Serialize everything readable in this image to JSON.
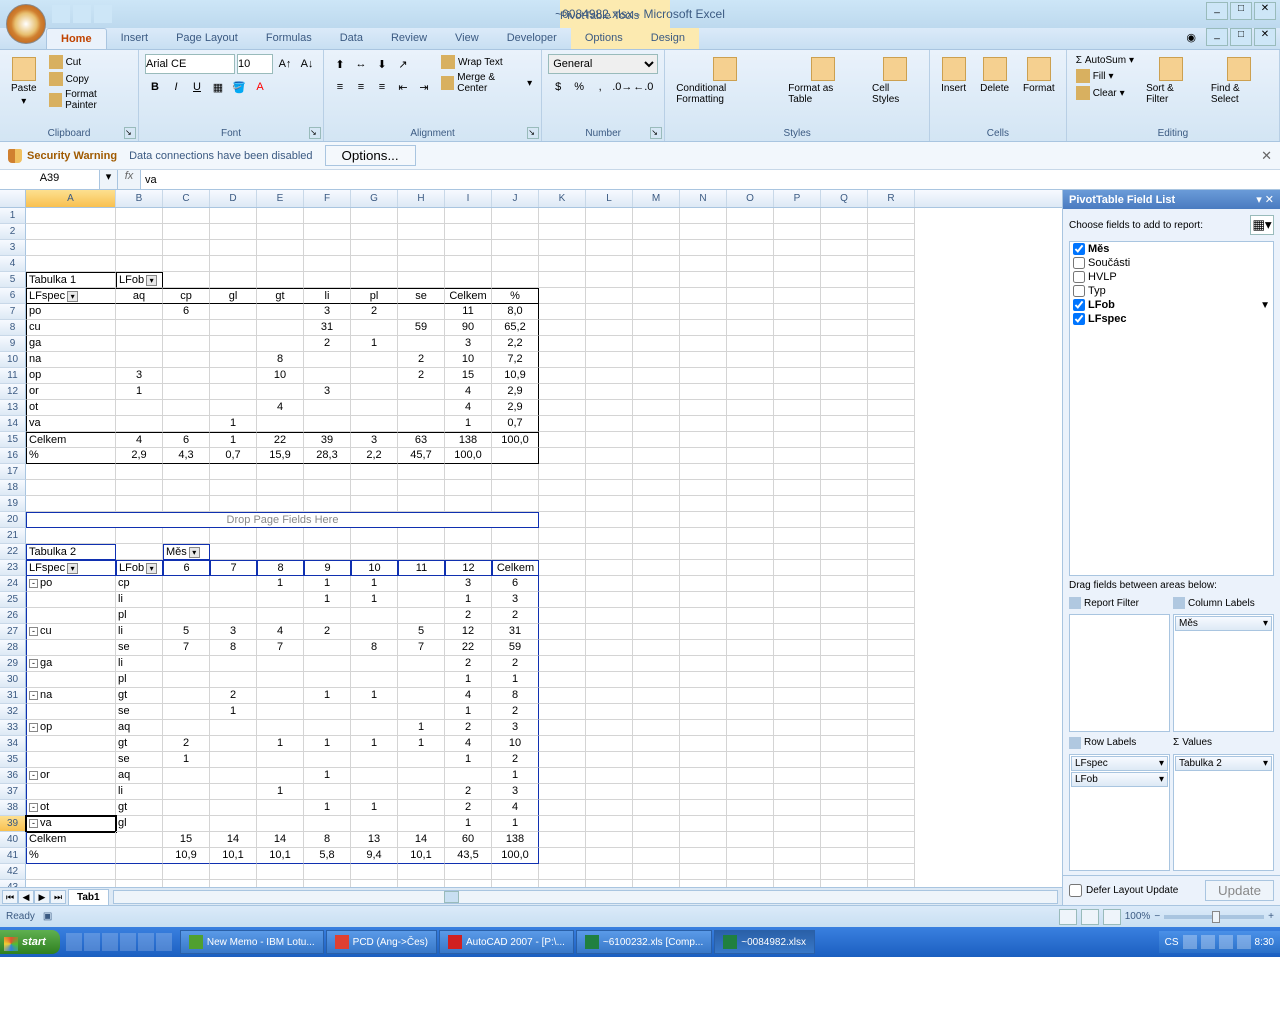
{
  "titlebar": {
    "title": "~0084982.xlsx - Microsoft Excel",
    "context_tools": "PivotTable Tools"
  },
  "ribbon_tabs": [
    "Home",
    "Insert",
    "Page Layout",
    "Formulas",
    "Data",
    "Review",
    "View",
    "Developer",
    "Options",
    "Design"
  ],
  "ribbon": {
    "clipboard": {
      "label": "Clipboard",
      "paste": "Paste",
      "cut": "Cut",
      "copy": "Copy",
      "format_painter": "Format Painter"
    },
    "font": {
      "label": "Font",
      "name": "Arial CE",
      "size": "10"
    },
    "alignment": {
      "label": "Alignment",
      "wrap": "Wrap Text",
      "merge": "Merge & Center"
    },
    "number": {
      "label": "Number",
      "format": "General"
    },
    "styles": {
      "label": "Styles",
      "cond": "Conditional Formatting",
      "table": "Format as Table",
      "cell": "Cell Styles"
    },
    "cells": {
      "label": "Cells",
      "insert": "Insert",
      "delete": "Delete",
      "format": "Format"
    },
    "editing": {
      "label": "Editing",
      "autosum": "AutoSum",
      "fill": "Fill",
      "clear": "Clear",
      "sort": "Sort & Filter",
      "find": "Find & Select"
    }
  },
  "security": {
    "warning": "Security Warning",
    "msg": "Data connections have been disabled",
    "options": "Options..."
  },
  "formula": {
    "name_box": "A39",
    "value": "va"
  },
  "columns": [
    "A",
    "B",
    "C",
    "D",
    "E",
    "F",
    "G",
    "H",
    "I",
    "J",
    "K",
    "L",
    "M",
    "N",
    "O",
    "P",
    "Q",
    "R"
  ],
  "sheet": {
    "t1_title": "Tabulka 1",
    "t1_hdr_row": [
      "LFspec",
      "aq",
      "cp",
      "gl",
      "gt",
      "li",
      "pl",
      "se",
      "Celkem",
      "%"
    ],
    "t1_lfob": "LFob",
    "t1_rows": [
      {
        "r": 7,
        "a": "po",
        "vals": [
          "",
          "6",
          "",
          "",
          "3",
          "2",
          "",
          "11",
          "8,0"
        ]
      },
      {
        "r": 8,
        "a": "cu",
        "vals": [
          "",
          "",
          "",
          "",
          "31",
          "",
          "59",
          "90",
          "65,2"
        ]
      },
      {
        "r": 9,
        "a": "ga",
        "vals": [
          "",
          "",
          "",
          "",
          "2",
          "1",
          "",
          "3",
          "2,2"
        ]
      },
      {
        "r": 10,
        "a": "na",
        "vals": [
          "",
          "",
          "",
          "8",
          "",
          "",
          "2",
          "10",
          "7,2"
        ]
      },
      {
        "r": 11,
        "a": "op",
        "vals": [
          "3",
          "",
          "",
          "10",
          "",
          "",
          "2",
          "15",
          "10,9"
        ]
      },
      {
        "r": 12,
        "a": "or",
        "vals": [
          "1",
          "",
          "",
          "",
          "3",
          "",
          "",
          "4",
          "2,9"
        ]
      },
      {
        "r": 13,
        "a": "ot",
        "vals": [
          "",
          "",
          "",
          "4",
          "",
          "",
          "",
          "4",
          "2,9"
        ]
      },
      {
        "r": 14,
        "a": "va",
        "vals": [
          "",
          "",
          "1",
          "",
          "",
          "",
          "",
          "1",
          "0,7"
        ]
      },
      {
        "r": 15,
        "a": "Celkem",
        "vals": [
          "4",
          "6",
          "1",
          "22",
          "39",
          "3",
          "63",
          "138",
          "100,0"
        ]
      },
      {
        "r": 16,
        "a": "%",
        "vals": [
          "2,9",
          "4,3",
          "0,7",
          "15,9",
          "28,3",
          "2,2",
          "45,7",
          "100,0",
          ""
        ]
      }
    ],
    "drop_zone": "Drop Page Fields Here",
    "t2_title": "Tabulka 2",
    "t2_mes": "Měs",
    "t2_hdr": [
      "LFspec",
      "LFob",
      "6",
      "7",
      "8",
      "9",
      "10",
      "11",
      "12",
      "Celkem"
    ],
    "t2_rows": [
      {
        "r": 24,
        "exp": "-",
        "a": "po",
        "b": "cp",
        "v": [
          "",
          "",
          "1",
          "1",
          "1",
          "",
          "3",
          "6"
        ]
      },
      {
        "r": 25,
        "exp": "",
        "a": "",
        "b": "li",
        "v": [
          "",
          "",
          "",
          "1",
          "1",
          "",
          "1",
          "3"
        ]
      },
      {
        "r": 26,
        "exp": "",
        "a": "",
        "b": "pl",
        "v": [
          "",
          "",
          "",
          "",
          "",
          "",
          "2",
          "2"
        ]
      },
      {
        "r": 27,
        "exp": "-",
        "a": "cu",
        "b": "li",
        "v": [
          "5",
          "3",
          "4",
          "2",
          "",
          "5",
          "12",
          "31"
        ]
      },
      {
        "r": 28,
        "exp": "",
        "a": "",
        "b": "se",
        "v": [
          "7",
          "8",
          "7",
          "",
          "8",
          "7",
          "22",
          "59"
        ]
      },
      {
        "r": 29,
        "exp": "-",
        "a": "ga",
        "b": "li",
        "v": [
          "",
          "",
          "",
          "",
          "",
          "",
          "2",
          "2"
        ]
      },
      {
        "r": 30,
        "exp": "",
        "a": "",
        "b": "pl",
        "v": [
          "",
          "",
          "",
          "",
          "",
          "",
          "1",
          "1"
        ]
      },
      {
        "r": 31,
        "exp": "-",
        "a": "na",
        "b": "gt",
        "v": [
          "",
          "2",
          "",
          "1",
          "1",
          "",
          "4",
          "8"
        ]
      },
      {
        "r": 32,
        "exp": "",
        "a": "",
        "b": "se",
        "v": [
          "",
          "1",
          "",
          "",
          "",
          "",
          "1",
          "2"
        ]
      },
      {
        "r": 33,
        "exp": "-",
        "a": "op",
        "b": "aq",
        "v": [
          "",
          "",
          "",
          "",
          "",
          "1",
          "2",
          "3"
        ]
      },
      {
        "r": 34,
        "exp": "",
        "a": "",
        "b": "gt",
        "v": [
          "2",
          "",
          "1",
          "1",
          "1",
          "1",
          "4",
          "10"
        ]
      },
      {
        "r": 35,
        "exp": "",
        "a": "",
        "b": "se",
        "v": [
          "1",
          "",
          "",
          "",
          "",
          "",
          "1",
          "2"
        ]
      },
      {
        "r": 36,
        "exp": "-",
        "a": "or",
        "b": "aq",
        "v": [
          "",
          "",
          "",
          "1",
          "",
          "",
          "",
          "1"
        ]
      },
      {
        "r": 37,
        "exp": "",
        "a": "",
        "b": "li",
        "v": [
          "",
          "",
          "1",
          "",
          "",
          "",
          "2",
          "3"
        ]
      },
      {
        "r": 38,
        "exp": "-",
        "a": "ot",
        "b": "gt",
        "v": [
          "",
          "",
          "",
          "1",
          "1",
          "",
          "2",
          "4"
        ]
      },
      {
        "r": 39,
        "exp": "-",
        "a": "va",
        "b": "gl",
        "v": [
          "",
          "",
          "",
          "",
          "",
          "",
          "1",
          "1"
        ]
      },
      {
        "r": 40,
        "exp": "",
        "a": "Celkem",
        "b": "",
        "v": [
          "15",
          "14",
          "14",
          "8",
          "13",
          "14",
          "60",
          "138"
        ]
      },
      {
        "r": 41,
        "exp": "",
        "a": "%",
        "b": "",
        "v": [
          "10,9",
          "10,1",
          "10,1",
          "5,8",
          "9,4",
          "10,1",
          "43,5",
          "100,0"
        ]
      }
    ]
  },
  "sheet_tab": "Tab1",
  "status": {
    "ready": "Ready",
    "zoom": "100%"
  },
  "field_pane": {
    "title": "PivotTable Field List",
    "choose": "Choose fields to add to report:",
    "fields": [
      {
        "name": "Měs",
        "checked": true,
        "bold": true
      },
      {
        "name": "Součásti",
        "checked": false,
        "bold": false
      },
      {
        "name": "HVLP",
        "checked": false,
        "bold": false
      },
      {
        "name": "Typ",
        "checked": false,
        "bold": false
      },
      {
        "name": "LFob",
        "checked": true,
        "bold": true,
        "filter": true
      },
      {
        "name": "LFspec",
        "checked": true,
        "bold": true
      }
    ],
    "drag_label": "Drag fields between areas below:",
    "areas": {
      "report_filter": "Report Filter",
      "column_labels": "Column Labels",
      "row_labels": "Row Labels",
      "values": "Values",
      "col_items": [
        "Měs"
      ],
      "row_items": [
        "LFspec",
        "LFob"
      ],
      "val_items": [
        "Tabulka 2"
      ]
    },
    "defer": "Defer Layout Update",
    "update": "Update"
  },
  "taskbar": {
    "start": "start",
    "items": [
      "New Memo - IBM Lotu...",
      "PCD (Ang->Čes)",
      "AutoCAD 2007 - [P:\\...",
      "~6100232.xls  [Comp...",
      "~0084982.xlsx"
    ],
    "lang": "CS",
    "time": "8:30"
  }
}
